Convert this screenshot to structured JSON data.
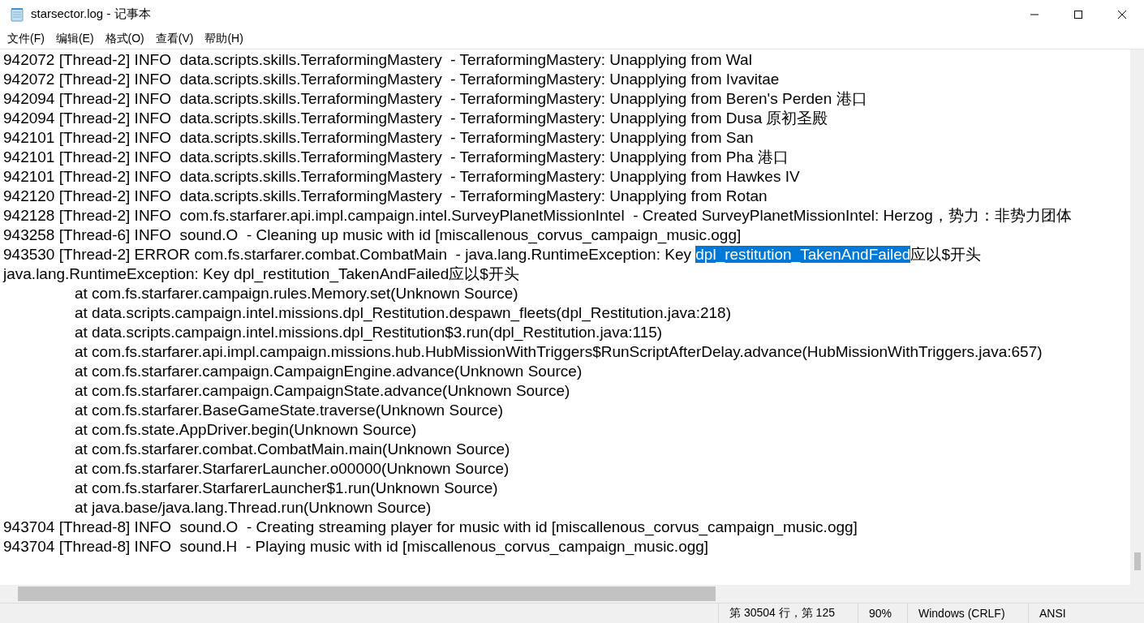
{
  "window": {
    "title": "starsector.log - 记事本"
  },
  "menu": [
    {
      "label": "文件(F)"
    },
    {
      "label": "编辑(E)"
    },
    {
      "label": "格式(O)"
    },
    {
      "label": "查看(V)"
    },
    {
      "label": "帮助(H)"
    }
  ],
  "lines": [
    {
      "text": "942072 [Thread-2] INFO  data.scripts.skills.TerraformingMastery  - TerraformingMastery: Unapplying from Wal",
      "indented": false
    },
    {
      "text": "942072 [Thread-2] INFO  data.scripts.skills.TerraformingMastery  - TerraformingMastery: Unapplying from Ivavitae",
      "indented": false
    },
    {
      "text": "942094 [Thread-2] INFO  data.scripts.skills.TerraformingMastery  - TerraformingMastery: Unapplying from Beren's Perden 港口",
      "indented": false
    },
    {
      "text": "942094 [Thread-2] INFO  data.scripts.skills.TerraformingMastery  - TerraformingMastery: Unapplying from Dusa 原初圣殿",
      "indented": false
    },
    {
      "text": "942101 [Thread-2] INFO  data.scripts.skills.TerraformingMastery  - TerraformingMastery: Unapplying from San",
      "indented": false
    },
    {
      "text": "942101 [Thread-2] INFO  data.scripts.skills.TerraformingMastery  - TerraformingMastery: Unapplying from Pha 港口",
      "indented": false
    },
    {
      "text": "942101 [Thread-2] INFO  data.scripts.skills.TerraformingMastery  - TerraformingMastery: Unapplying from Hawkes IV",
      "indented": false
    },
    {
      "text": "942120 [Thread-2] INFO  data.scripts.skills.TerraformingMastery  - TerraformingMastery: Unapplying from Rotan",
      "indented": false
    },
    {
      "text": "942128 [Thread-2] INFO  com.fs.starfarer.api.impl.campaign.intel.SurveyPlanetMissionIntel  - Created SurveyPlanetMissionIntel: Herzog，势力：非势力团体",
      "indented": false
    },
    {
      "text": "943258 [Thread-6] INFO  sound.O  - Cleaning up music with id [miscallenous_corvus_campaign_music.ogg]",
      "indented": false
    },
    {
      "text": "943530 [Thread-2] ERROR com.fs.starfarer.combat.CombatMain  - java.lang.RuntimeException: Key ",
      "selection": "dpl_restitution_TakenAndFailed",
      "after": "应以$开头",
      "indented": false
    },
    {
      "text": "java.lang.RuntimeException: Key dpl_restitution_TakenAndFailed应以$开头",
      "indented": false
    },
    {
      "text": "at com.fs.starfarer.campaign.rules.Memory.set(Unknown Source)",
      "indented": true
    },
    {
      "text": "at data.scripts.campaign.intel.missions.dpl_Restitution.despawn_fleets(dpl_Restitution.java:218)",
      "indented": true
    },
    {
      "text": "at data.scripts.campaign.intel.missions.dpl_Restitution$3.run(dpl_Restitution.java:115)",
      "indented": true
    },
    {
      "text": "at com.fs.starfarer.api.impl.campaign.missions.hub.HubMissionWithTriggers$RunScriptAfterDelay.advance(HubMissionWithTriggers.java:657)",
      "indented": true
    },
    {
      "text": "at com.fs.starfarer.campaign.CampaignEngine.advance(Unknown Source)",
      "indented": true
    },
    {
      "text": "at com.fs.starfarer.campaign.CampaignState.advance(Unknown Source)",
      "indented": true
    },
    {
      "text": "at com.fs.starfarer.BaseGameState.traverse(Unknown Source)",
      "indented": true
    },
    {
      "text": "at com.fs.state.AppDriver.begin(Unknown Source)",
      "indented": true
    },
    {
      "text": "at com.fs.starfarer.combat.CombatMain.main(Unknown Source)",
      "indented": true
    },
    {
      "text": "at com.fs.starfarer.StarfarerLauncher.o00000(Unknown Source)",
      "indented": true
    },
    {
      "text": "at com.fs.starfarer.StarfarerLauncher$1.run(Unknown Source)",
      "indented": true
    },
    {
      "text": "at java.base/java.lang.Thread.run(Unknown Source)",
      "indented": true
    },
    {
      "text": "943704 [Thread-8] INFO  sound.O  - Creating streaming player for music with id [miscallenous_corvus_campaign_music.ogg]",
      "indented": false
    },
    {
      "text": "943704 [Thread-8] INFO  sound.H  - Playing music with id [miscallenous_corvus_campaign_music.ogg]",
      "indented": false
    }
  ],
  "status_bar": {
    "position": "第 30504 行，第 125",
    "zoom": "90%",
    "line_ending": "Windows (CRLF)",
    "encoding": "ANSI"
  }
}
